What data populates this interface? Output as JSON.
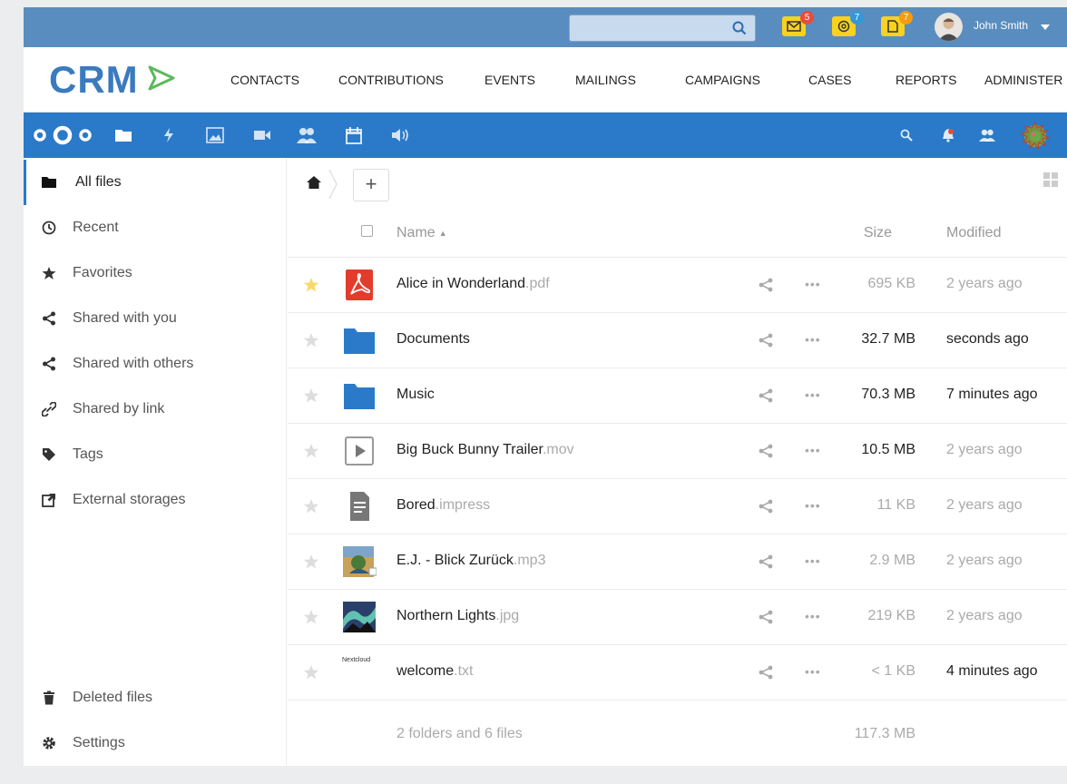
{
  "topbar": {
    "search_placeholder": "",
    "notifications": [
      {
        "icon": "mail-icon",
        "count": "5",
        "badge_color": "#e74c3c"
      },
      {
        "icon": "at-icon",
        "count": "7",
        "badge_color": "#3498db"
      },
      {
        "icon": "document-icon",
        "count": "7",
        "badge_color": "#f39c12"
      }
    ],
    "user_name": "John Smith"
  },
  "crm": {
    "logo_text": "CRM",
    "nav": [
      "CONTACTS",
      "CONTRIBUTIONS",
      "EVENTS",
      "MAILINGS",
      "CAMPAIGNS",
      "CASES",
      "REPORTS",
      "ADMINISTER"
    ]
  },
  "nextcloud_bar": {
    "apps": [
      "files-icon",
      "activity-icon",
      "gallery-icon",
      "video-icon",
      "contacts-icon",
      "calendar-icon",
      "audio-icon"
    ],
    "right": [
      "search-icon",
      "notifications-icon",
      "contacts-menu-icon",
      "user-avatar"
    ]
  },
  "sidebar": {
    "items": [
      {
        "label": "All files",
        "icon": "folder-icon",
        "active": true
      },
      {
        "label": "Recent",
        "icon": "clock-icon"
      },
      {
        "label": "Favorites",
        "icon": "star-icon"
      },
      {
        "label": "Shared with you",
        "icon": "share-icon"
      },
      {
        "label": "Shared with others",
        "icon": "share-icon"
      },
      {
        "label": "Shared by link",
        "icon": "link-icon"
      },
      {
        "label": "Tags",
        "icon": "tag-icon"
      },
      {
        "label": "External storages",
        "icon": "external-icon"
      }
    ],
    "footer": [
      {
        "label": "Deleted files",
        "icon": "trash-icon"
      },
      {
        "label": "Settings",
        "icon": "gear-icon"
      }
    ]
  },
  "files": {
    "add_label": "+",
    "headers": {
      "name": "Name",
      "size": "Size",
      "modified": "Modified"
    },
    "rows": [
      {
        "name": "Alice in Wonderland",
        "ext": ".pdf",
        "size": "695 KB",
        "modified": "2 years ago",
        "icon": "pdf-icon",
        "favorite": true,
        "recent": false
      },
      {
        "name": "Documents",
        "ext": "",
        "size": "32.7 MB",
        "modified": "seconds ago",
        "icon": "folder-icon",
        "favorite": false,
        "recent": true
      },
      {
        "name": "Music",
        "ext": "",
        "size": "70.3 MB",
        "modified": "7 minutes ago",
        "icon": "folder-icon",
        "favorite": false,
        "recent": true
      },
      {
        "name": "Big Buck Bunny Trailer",
        "ext": ".mov",
        "size": "10.5 MB",
        "modified": "2 years ago",
        "icon": "video-file-icon",
        "favorite": false,
        "recent": true
      },
      {
        "name": "Bored",
        "ext": ".impress",
        "size": "11 KB",
        "modified": "2 years ago",
        "icon": "text-document-icon",
        "favorite": false,
        "recent": false
      },
      {
        "name": "E.J. - Blick Zurück",
        "ext": ".mp3",
        "size": "2.9 MB",
        "modified": "2 years ago",
        "icon": "album-art-thumbnail",
        "favorite": false,
        "recent": false
      },
      {
        "name": "Northern Lights",
        "ext": ".jpg",
        "size": "219 KB",
        "modified": "2 years ago",
        "icon": "aurora-thumbnail",
        "favorite": false,
        "recent": false
      },
      {
        "name": "welcome",
        "ext": ".txt",
        "size": "< 1 KB",
        "modified": "4 minutes ago",
        "icon": "text-thumbnail",
        "thumb_text": "Nextcloud",
        "favorite": false,
        "recent": true
      }
    ],
    "summary": {
      "text": "2 folders and 6 files",
      "size": "117.3 MB"
    }
  },
  "colors": {
    "topbar": "#5a8dbf",
    "nextcloud": "#2b7ac9",
    "notif_yellow": "#f7d21e",
    "folder_blue": "#2b7ac9",
    "pdf_red": "#e23c2d",
    "favorite_star": "#f7d96b"
  }
}
